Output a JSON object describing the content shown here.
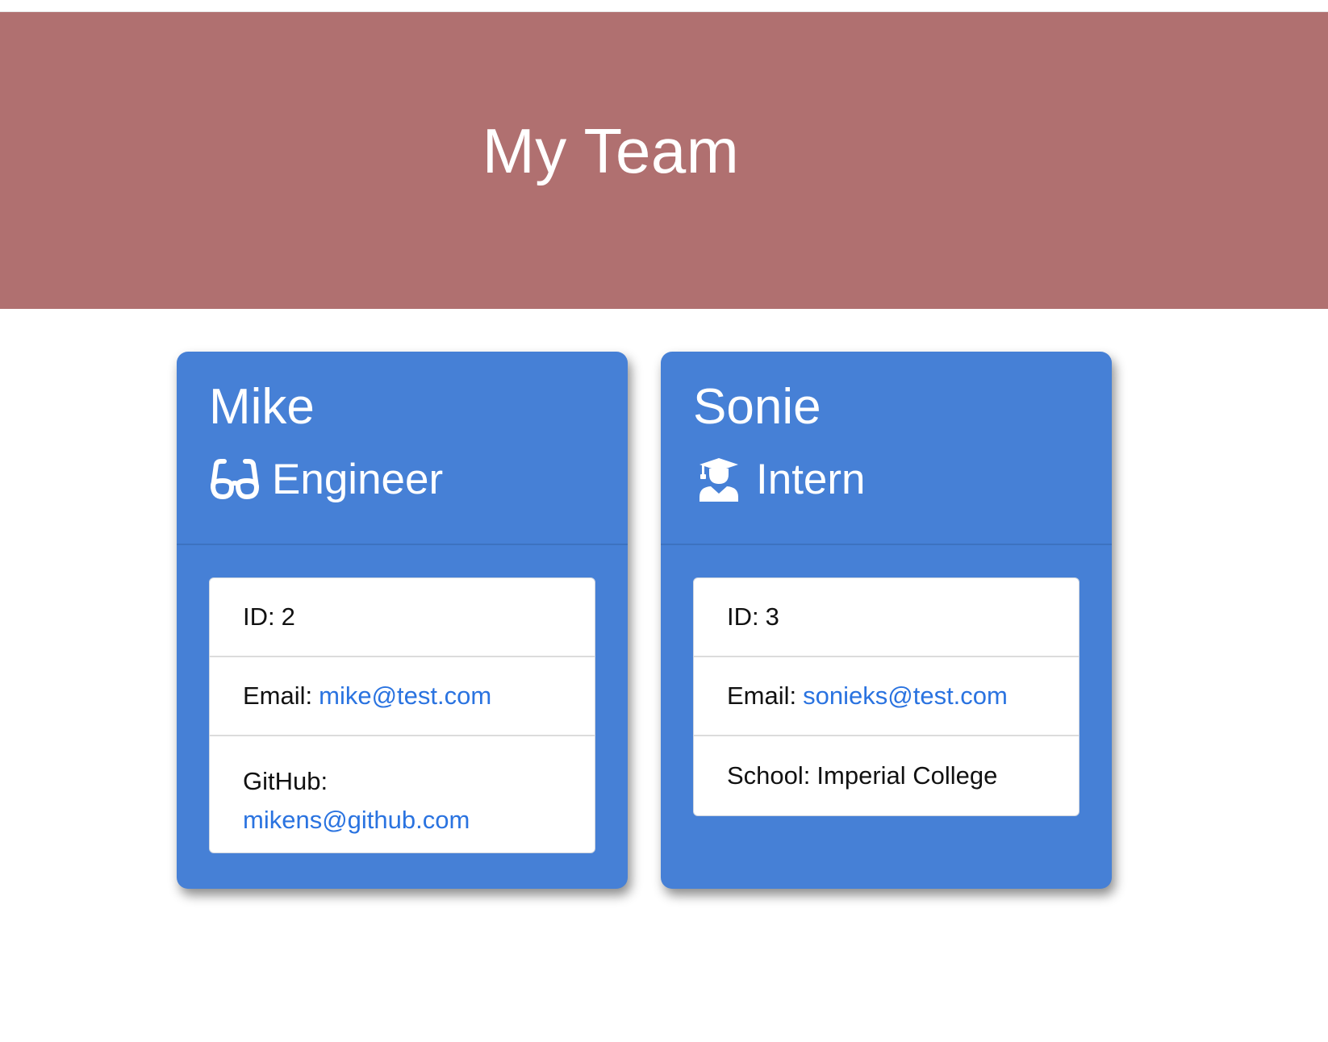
{
  "header": {
    "title": "My Team"
  },
  "colors": {
    "header_bg": "#b07070",
    "card_bg": "#4680d6",
    "link": "#2a73e0"
  },
  "cards": [
    {
      "name": "Mike",
      "role": "Engineer",
      "role_icon": "glasses-icon",
      "id_label": "ID:",
      "id_value": "2",
      "email_label": "Email:",
      "email": "mike@test.com",
      "extra_label": "GitHub:",
      "extra_value": "mikens@github.com"
    },
    {
      "name": "Sonie",
      "role": "Intern",
      "role_icon": "graduate-icon",
      "id_label": "ID:",
      "id_value": "3",
      "email_label": "Email:",
      "email": "sonieks@test.com",
      "extra_label": "School:",
      "extra_value": "Imperial College"
    }
  ]
}
